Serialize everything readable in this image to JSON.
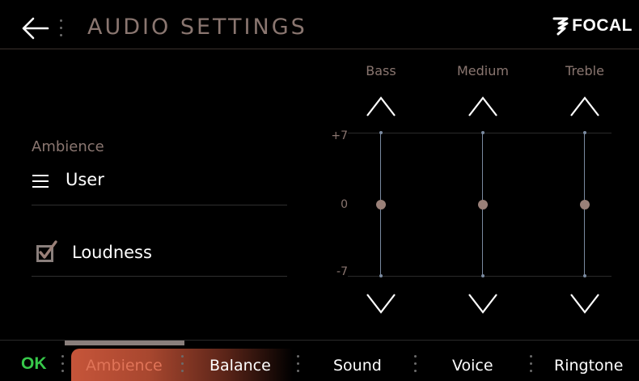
{
  "header": {
    "title": "AUDIO SETTINGS",
    "brand": "FOCAL",
    "back_icon": "back-arrow-icon"
  },
  "ambience": {
    "label": "Ambience",
    "value": "User",
    "menu_icon": "hamburger-menu-icon"
  },
  "loudness": {
    "label": "Loudness",
    "checked": true
  },
  "equalizer": {
    "scale": {
      "max": "+7",
      "mid": "0",
      "min": "-7"
    },
    "bands": [
      {
        "name": "Bass",
        "value": 0
      },
      {
        "name": "Medium",
        "value": 0
      },
      {
        "name": "Treble",
        "value": 0
      }
    ]
  },
  "bottom_bar": {
    "ok_label": "OK",
    "tabs": [
      {
        "label": "Ambience",
        "active": true
      },
      {
        "label": "Balance",
        "active": false
      },
      {
        "label": "Sound",
        "active": false
      },
      {
        "label": "Voice",
        "active": false
      },
      {
        "label": "Ringtone",
        "active": false
      }
    ]
  },
  "colors": {
    "accent_text": "#8a7670",
    "ok_green": "#37c84a",
    "active_tab_orange": "#c6553a"
  }
}
